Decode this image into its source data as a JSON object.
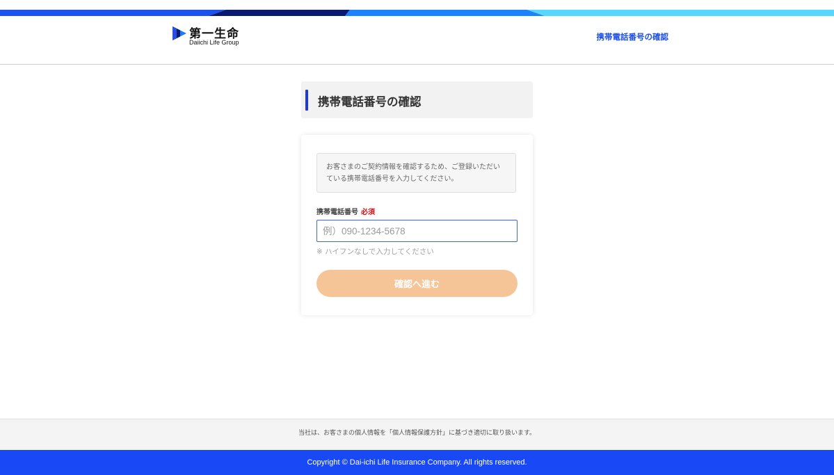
{
  "brand": {
    "name_jp": "第一生命",
    "name_en": "Daiichi Life Group",
    "logo_icon": "daiichi-life-mark",
    "colors": {
      "accent_blue": "#1e50e6",
      "stripe_navy": "#0a1a6e",
      "stripe_blue": "#1c82ff",
      "stripe_cyan": "#55d7ff",
      "button_disabled": "#f6c597",
      "required_red": "#d0121b",
      "footer_blue": "#1948f5"
    }
  },
  "header": {
    "link": "携帯電話番号の確認"
  },
  "page": {
    "title": "携帯電話番号の確認"
  },
  "form": {
    "notice": "お客さまのご契約情報を確認するため、ご登録いただいている携帯電話番号を入力してください。",
    "phone_label": "携帯電話番号",
    "required_badge": "必須",
    "phone_value": "",
    "phone_placeholder": "例）090-1234-5678",
    "hint": "※ ハイフンなしで入力してください",
    "submit_label": "確認へ進む"
  },
  "footer": {
    "privacy_note": "当社は、お客さまの個人情報を「個人情報保護方針」に基づき適切に取り扱います。",
    "copyright": "Copyright © Dai-ichi Life Insurance Company. All rights reserved."
  }
}
